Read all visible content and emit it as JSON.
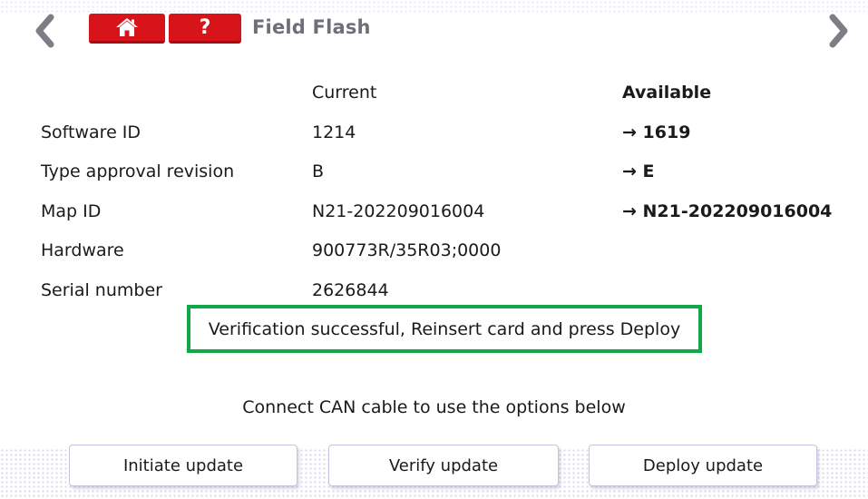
{
  "header": {
    "title": "Field Flash",
    "help_label": "?",
    "home_icon": "home-icon",
    "back_icon": "chevron-left-icon",
    "forward_icon": "chevron-right-icon",
    "accent_color": "#d7141a"
  },
  "columns": {
    "current": "Current",
    "available": "Available"
  },
  "rows": [
    {
      "label": "Software ID",
      "current": "1214",
      "available": "→ 1619"
    },
    {
      "label": "Type approval revision",
      "current": "B",
      "available": "→ E"
    },
    {
      "label": "Map ID",
      "current": "N21-202209016004",
      "available": "→ N21-202209016004"
    },
    {
      "label": "Hardware",
      "current": "900773R/35R03;0000",
      "available": ""
    },
    {
      "label": "Serial number",
      "current": "2626844",
      "available": ""
    }
  ],
  "status": {
    "message": "Verification successful, Reinsert card and press Deploy",
    "border_color": "#11a84a"
  },
  "hint": "Connect CAN cable to use the options below",
  "actions": {
    "initiate": "Initiate update",
    "verify": "Verify update",
    "deploy": "Deploy update"
  }
}
